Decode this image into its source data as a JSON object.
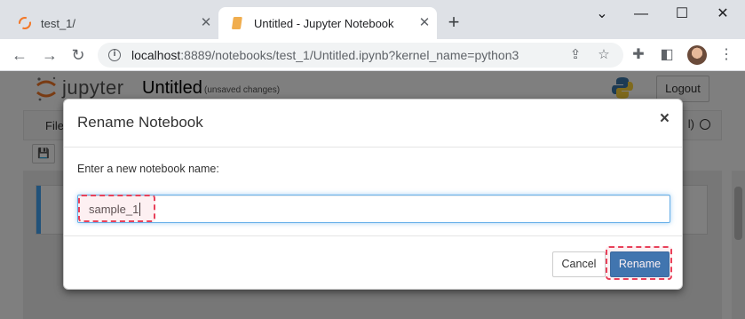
{
  "browser": {
    "tabs": [
      {
        "title": "test_1/",
        "active": false
      },
      {
        "title": "Untitled - Jupyter Notebook",
        "active": true
      }
    ],
    "url_host": "localhost",
    "url_rest": ":8889/notebooks/test_1/Untitled.ipynb?kernel_name=python3"
  },
  "jupyter": {
    "brand": "jupyter",
    "notebook_title": "Untitled",
    "status": "(unsaved changes)",
    "logout_label": "Logout",
    "menu_file": "File",
    "kernel_indicator": "l)"
  },
  "dialog": {
    "title": "Rename Notebook",
    "close_glyph": "×",
    "prompt": "Enter a new notebook name:",
    "input_value": "sample_1",
    "cancel_label": "Cancel",
    "rename_label": "Rename"
  },
  "colors": {
    "primary_button": "#337ab7",
    "highlight": "#e8415a",
    "focus_border": "#66afe9"
  }
}
